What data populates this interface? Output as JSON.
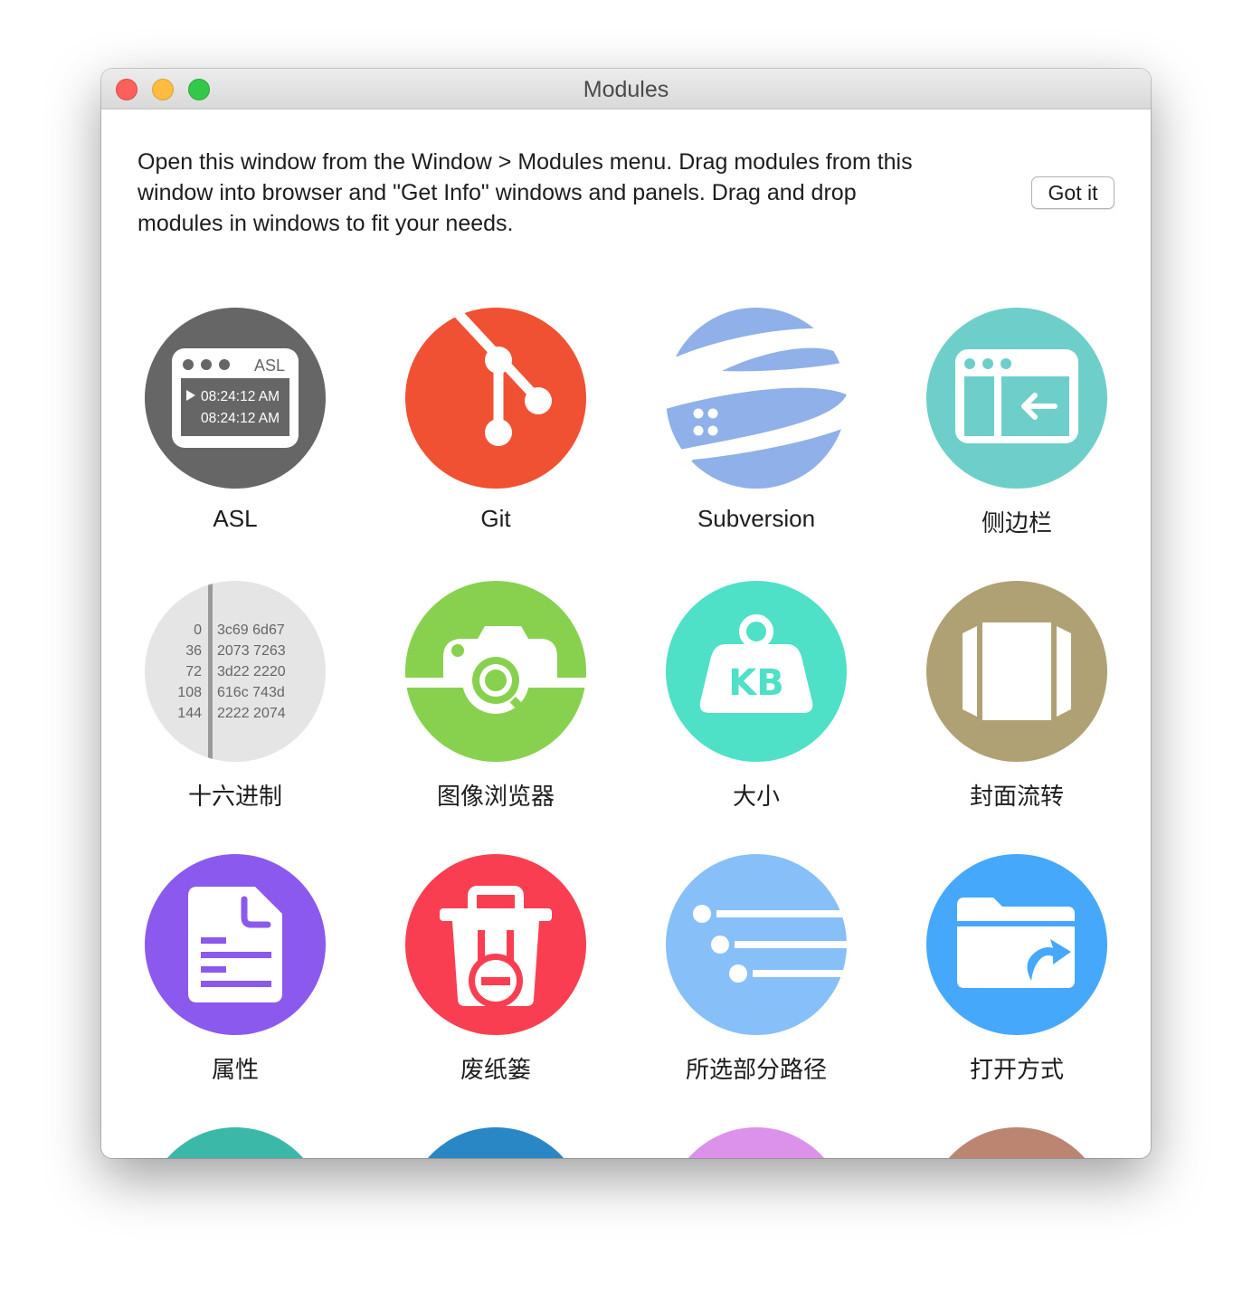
{
  "window": {
    "title": "Modules"
  },
  "intro": {
    "line1": "Open this window from the Window > Modules menu. Drag modules from this",
    "line2": "window into browser and \"Get Info\" windows and panels. Drag and drop",
    "line3": "modules in windows to fit your needs.",
    "button": "Got it"
  },
  "modules": [
    {
      "label": "ASL",
      "color": "#666666",
      "icon": "asl-icon"
    },
    {
      "label": "Git",
      "color": "#f05133",
      "icon": "git-icon"
    },
    {
      "label": "Subversion",
      "color": "#8fb0e8",
      "icon": "subversion-icon"
    },
    {
      "label": "侧边栏",
      "color": "#6ecfca",
      "icon": "sidebar-icon"
    },
    {
      "label": "十六进制",
      "color": "#e5e5e5",
      "icon": "hex-icon"
    },
    {
      "label": "图像浏览器",
      "color": "#88d14e",
      "icon": "camera-icon"
    },
    {
      "label": "大小",
      "color": "#4ee1c7",
      "icon": "weight-icon"
    },
    {
      "label": "封面流转",
      "color": "#b0a174",
      "icon": "coverflow-icon"
    },
    {
      "label": "属性",
      "color": "#8b59ed",
      "icon": "document-icon"
    },
    {
      "label": "废纸篓",
      "color": "#fa3e51",
      "icon": "trash-icon"
    },
    {
      "label": "所选部分路径",
      "color": "#87bff9",
      "icon": "path-list-icon"
    },
    {
      "label": "打开方式",
      "color": "#46a8fa",
      "icon": "folder-open-icon"
    }
  ],
  "asl_icon": {
    "badge": "ASL",
    "time1": "08:24:12 AM",
    "time2": "08:24:12 AM"
  },
  "hex_icon": {
    "offsets": [
      "0",
      "36",
      "72",
      "108",
      "144"
    ],
    "bytes": [
      "3c69 6d67",
      "2073 7263",
      "3d22 2220",
      "616c 743d",
      "2222 2074"
    ]
  },
  "weight_icon": {
    "text": "KB"
  },
  "partial_row_colors": [
    "#3bb8a8",
    "#2a87c6",
    "#dc92ea",
    "#bb8572"
  ]
}
